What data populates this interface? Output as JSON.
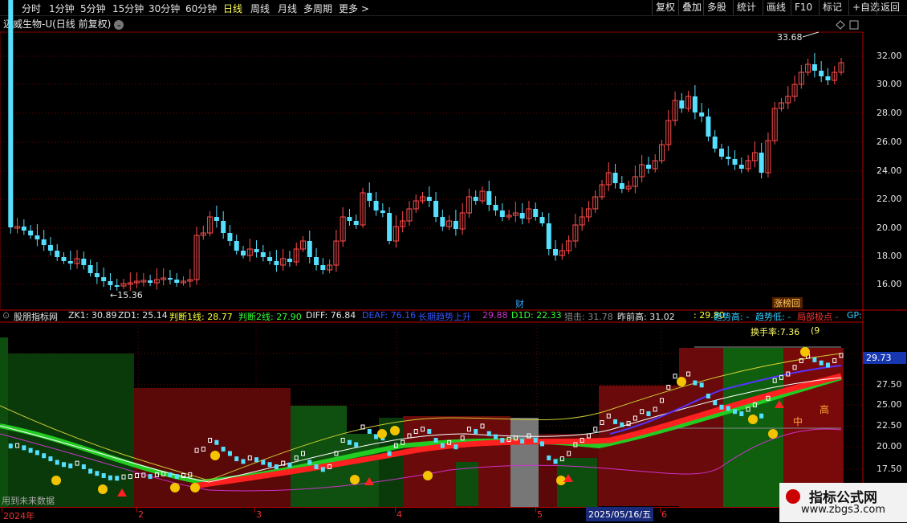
{
  "toolbar": {
    "timeframes": [
      "分时",
      "1分钟",
      "5分钟",
      "15分钟",
      "30分钟",
      "60分钟",
      "日线",
      "周线",
      "月线",
      "多周期",
      "更多"
    ],
    "active": "日线",
    "right_buttons": [
      "复权",
      "叠加",
      "多股",
      "统计",
      "画线",
      "F10",
      "标记",
      "+自选",
      "返回"
    ]
  },
  "main_chart": {
    "title": "迈威生物-U(日线 前复权)",
    "y_ticks": [
      "32.00",
      "30.00",
      "28.00",
      "26.00",
      "24.00",
      "22.00",
      "20.00",
      "18.00",
      "16.00"
    ],
    "high_marker": "33.68",
    "low_marker": "15.36",
    "badge_cai": "财",
    "badge_zhangting": "涨榜回"
  },
  "indicator": {
    "name": "股朋指标网",
    "values": [
      {
        "text": "ZK1: 30.89",
        "color": "#e6e6e6"
      },
      {
        "text": "ZD1: 25.14",
        "color": "#e6e6e6"
      },
      {
        "text": "判断1线: 28.77",
        "color": "#ffff33"
      },
      {
        "text": "判断2线: 27.90",
        "color": "#33ff33"
      },
      {
        "text": "DIFF: 76.84",
        "color": "#e6e6e6"
      },
      {
        "text": "DEAF: 76.16",
        "color": "#3355ff"
      },
      {
        "text": "长期趋势上升",
        "color": "#3355ff"
      },
      {
        "text": "29.88",
        "color": "#cc33cc"
      },
      {
        "text": "D1D: 22.33",
        "color": "#33ff33"
      },
      {
        "text": "猎击: 31.78",
        "color": "#888888"
      },
      {
        "text": "昨前高: 31.02",
        "color": "#e6e6e6"
      },
      {
        "text": ": 29.80",
        "color": "#ffff33"
      },
      {
        "text": "趋势高: -",
        "color": "#33ccff"
      },
      {
        "text": "趋势低: -",
        "color": "#33ccff"
      },
      {
        "text": "局部极点 -",
        "color": "#ff3333"
      },
      {
        "text": "GP:",
        "color": "#33ccff"
      }
    ],
    "turnover": "换手率:7.36",
    "turnover_tail": "(9",
    "y_ticks": [
      "27.50",
      "25.00",
      "22.50",
      "20.00",
      "17.50"
    ],
    "current_value": "29.73",
    "label_gao": "高",
    "label_zhong": "中",
    "bottom_note": "用到未来数据"
  },
  "date_axis": {
    "labels": [
      "2024年",
      "2",
      "3",
      "4",
      "5",
      "6"
    ],
    "selected_date": "2025/05/16/五"
  },
  "watermark": {
    "line1": "指标公式网",
    "line2": "www.zbgs3.com"
  }
}
